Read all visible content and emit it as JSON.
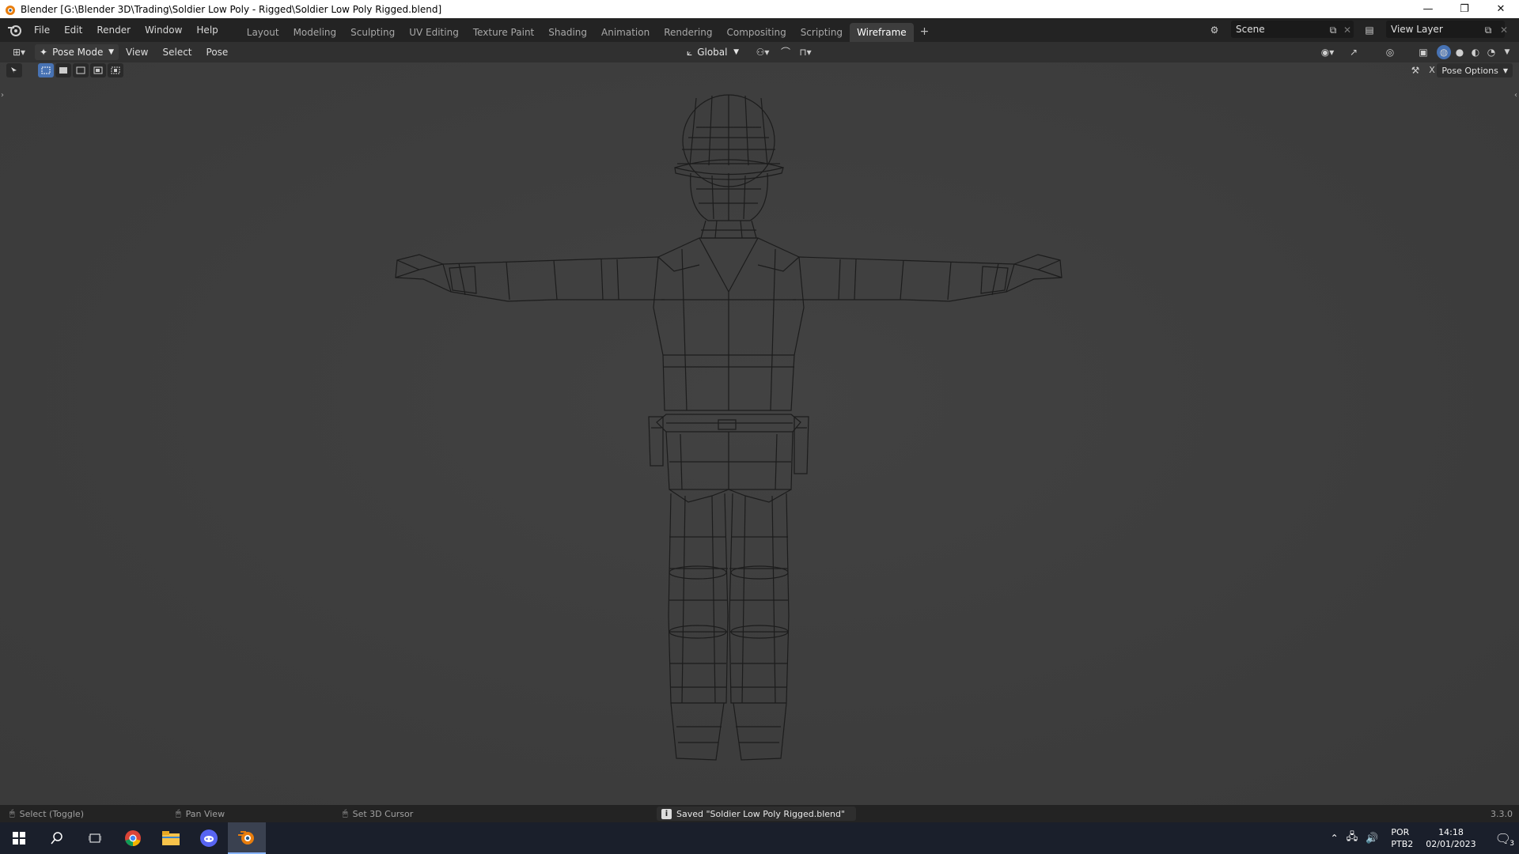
{
  "window": {
    "title": "Blender [G:\\Blender 3D\\Trading\\Soldier Low Poly - Rigged\\Soldier Low Poly Rigged.blend]",
    "minimize": "—",
    "restore": "❐",
    "close": "✕"
  },
  "menu": {
    "items": [
      "File",
      "Edit",
      "Render",
      "Window",
      "Help"
    ]
  },
  "workspaces": {
    "tabs": [
      "Layout",
      "Modeling",
      "Sculpting",
      "UV Editing",
      "Texture Paint",
      "Shading",
      "Animation",
      "Rendering",
      "Compositing",
      "Scripting",
      "Wireframe"
    ],
    "active": "Wireframe",
    "add": "+"
  },
  "scene": {
    "label": "Scene"
  },
  "view_layer": {
    "label": "View Layer"
  },
  "header3d": {
    "mode": "Pose Mode",
    "menus": [
      "View",
      "Select",
      "Pose"
    ],
    "orientation": "Global",
    "pose_options": "Pose Options"
  },
  "status": {
    "left": "Select (Toggle)",
    "middle": "Pan View",
    "right": "Set 3D Cursor",
    "message": "Saved \"Soldier Low Poly Rigged.blend\"",
    "version": "3.3.0"
  },
  "taskbar": {
    "lang_top": "POR",
    "lang_bottom": "PTB2",
    "time": "14:18",
    "date": "02/01/2023",
    "notifications": "3"
  },
  "colors": {
    "accent": "#4772b3",
    "viewport_bg": "#3d3d3d",
    "wire": "#1b1b1b"
  }
}
